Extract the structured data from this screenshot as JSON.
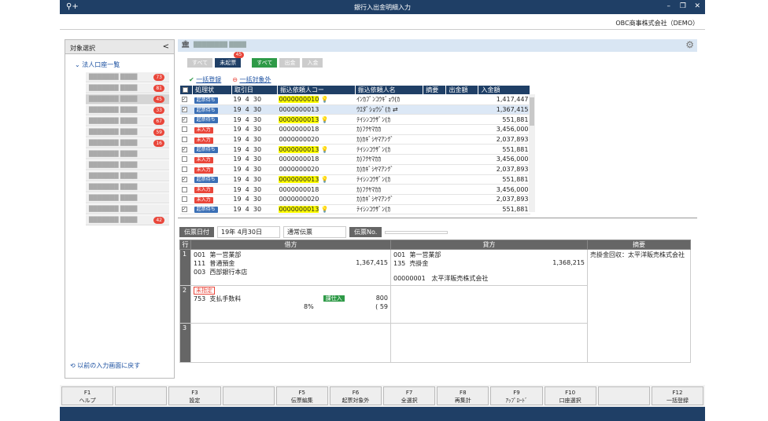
{
  "title": "銀行入出金明細入力",
  "company": "OBC商事株式会社（DEMO）",
  "left": {
    "header": "対象選択",
    "group": "法人口座一覧",
    "back": "以前の入力画面に戻す",
    "accounts": [
      {
        "b": "73"
      },
      {
        "b": "81"
      },
      {
        "b": "45",
        "sel": true
      },
      {
        "b": "33"
      },
      {
        "b": "67"
      },
      {
        "b": "59"
      },
      {
        "b": "16"
      },
      {
        "b": ""
      },
      {
        "b": ""
      },
      {
        "b": ""
      },
      {
        "b": ""
      },
      {
        "b": ""
      },
      {
        "b": ""
      },
      {
        "b": "42"
      }
    ]
  },
  "filters": {
    "all1": "すべて",
    "unrecorded": "未起票",
    "count": "45",
    "all2": "すべて",
    "out": "出金",
    "in": "入金"
  },
  "actions": {
    "bulk": "一括登録",
    "exclude": "一括対象外"
  },
  "grid": {
    "headers": [
      "処理状",
      "取引日",
      "振込依頼人コー",
      "振込依頼人名",
      "摘要",
      "出金額",
      "入金額"
    ],
    "rows": [
      [
        "起票待ち",
        "19",
        "4",
        "30",
        "0000000010",
        "ｲﾝｶﾌﾞﾝｺｳｷﾞｮｳ(ｶ",
        "1,417,447",
        1,
        1
      ],
      [
        "起票待ち",
        "19",
        "4",
        "30",
        "0000000013",
        "ｳｴﾀﾞｼｮｳｼﾞ(ｶ",
        "1,367,415",
        1,
        0
      ],
      [
        "起票待ち",
        "19",
        "4",
        "30",
        "0000000013",
        "ﾃｲｼﾝｺｳｻﾞﾝ(ｶ",
        "551,881",
        1,
        1
      ],
      [
        "未入力",
        "19",
        "4",
        "30",
        "0000000018",
        "ｶ)ﾌｸﾔﾏｶｶ",
        "3,456,000",
        0,
        0
      ],
      [
        "未入力",
        "19",
        "4",
        "30",
        "0000000020",
        "ｶ)ｶｷﾞｼﾔﾏｱﾝｸﾞ",
        "2,037,893",
        0,
        0
      ],
      [
        "起票待ち",
        "19",
        "4",
        "30",
        "0000000013",
        "ﾃｲｼﾝｺｳｻﾞﾝ(ｶ",
        "551,881",
        1,
        1
      ],
      [
        "未入力",
        "19",
        "4",
        "30",
        "0000000018",
        "ｶ)ﾌｸﾔﾏｶｶ",
        "3,456,000",
        0,
        0
      ],
      [
        "未入力",
        "19",
        "4",
        "30",
        "0000000020",
        "ｶ)ｶｷﾞｼﾔﾏｱﾝｸﾞ",
        "2,037,893",
        0,
        0
      ],
      [
        "起票待ち",
        "19",
        "4",
        "30",
        "0000000013",
        "ﾃｲｼﾝｺｳｻﾞﾝ(ｶ",
        "551,881",
        1,
        1
      ],
      [
        "未入力",
        "19",
        "4",
        "30",
        "0000000018",
        "ｶ)ﾌｸﾔﾏｶｶ",
        "3,456,000",
        0,
        0
      ],
      [
        "未入力",
        "19",
        "4",
        "30",
        "0000000020",
        "ｶ)ｶｷﾞｼﾔﾏｱﾝｸﾞ",
        "2,037,893",
        0,
        0
      ],
      [
        "起票待ち",
        "19",
        "4",
        "30",
        "0000000013",
        "ﾃｲｼﾝｺｳｻﾞﾝ(ｶ",
        "551,881",
        1,
        1
      ]
    ]
  },
  "voucher": {
    "date_label": "伝票日付",
    "date": "19年 4月30日",
    "type": "通常伝票",
    "no_label": "伝票No.",
    "hdr": {
      "row": "行",
      "debit": "借方",
      "credit": "貸方",
      "memo": "摘要"
    },
    "memo": "売掛金回収：太平洋販売株式会社",
    "r1": {
      "dc": "001",
      "dname": "第一営業部",
      "da": "111",
      "daname": "普通預金",
      "dam": "1,367,415",
      "db": "003",
      "dbname": "西部銀行本店",
      "cc": "001",
      "cname": "第一営業部",
      "ca": "135",
      "caname": "売掛金",
      "cam": "1,368,215",
      "cp": "00000001",
      "cpname": "太平洋販売株式会社"
    },
    "r2": {
      "tag": "未指定",
      "code": "753",
      "name": "支払手数料",
      "tax": "課仕入",
      "amt": "800",
      "rate": "8%",
      "tamt": "( 59"
    }
  },
  "fn": [
    [
      "F1",
      "ヘルプ"
    ],
    [
      "",
      ""
    ],
    [
      "F3",
      "設定"
    ],
    [
      "",
      ""
    ],
    [
      "F5",
      "伝票編集"
    ],
    [
      "F6",
      "起票対象外"
    ],
    [
      "F7",
      "全選択"
    ],
    [
      "F8",
      "再集計"
    ],
    [
      "F9",
      "ｱｯﾌﾟﾛｰﾄﾞ"
    ],
    [
      "F10",
      "口座選択"
    ],
    [
      "",
      ""
    ],
    [
      "F12",
      "一括登録"
    ]
  ]
}
